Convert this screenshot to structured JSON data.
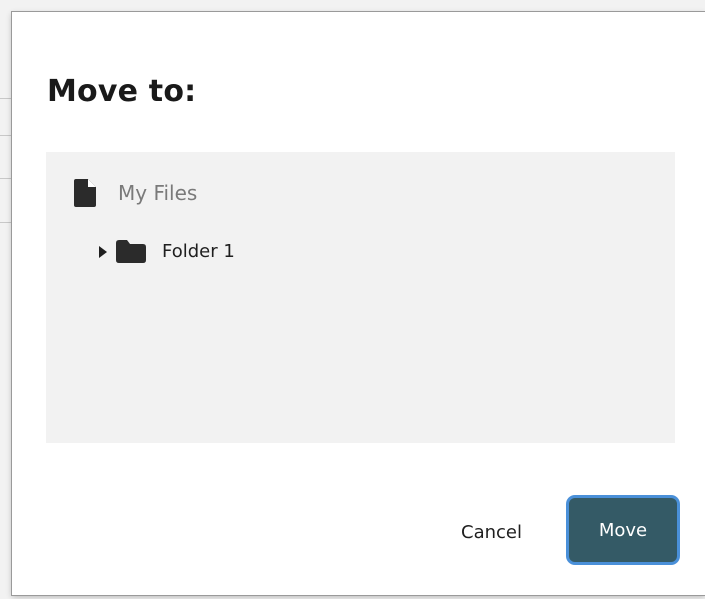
{
  "dialog": {
    "title": "Move to:",
    "tree": {
      "root": {
        "label": "My Files",
        "icon": "file-icon"
      },
      "items": [
        {
          "label": "Folder 1",
          "icon": "folder-icon",
          "toggle_icon": "caret-right-icon",
          "expanded": false
        }
      ]
    },
    "actions": {
      "cancel_label": "Cancel",
      "move_label": "Move"
    }
  },
  "colors": {
    "primary_button": "#345a66",
    "focus_ring": "#4a90d9",
    "panel_background": "#f2f2f2",
    "muted_text": "#7a7a7a"
  }
}
